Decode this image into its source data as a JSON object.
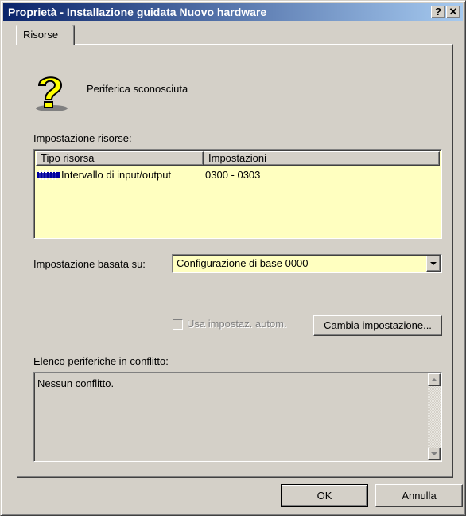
{
  "window": {
    "title": "Proprietà - Installazione guidata Nuovo hardware",
    "help_label": "?",
    "close_label": "✕"
  },
  "tabs": [
    {
      "label": "Risorse"
    }
  ],
  "device": {
    "name": "Periferica sconosciuta",
    "icon": "question-mark-icon"
  },
  "resources": {
    "label": "Impostazione risorse:",
    "columns": [
      "Tipo risorsa",
      "Impostazioni"
    ],
    "rows": [
      {
        "icon": "chip-icon",
        "type": "Intervallo di input/output",
        "value": "0300 - 0303"
      }
    ]
  },
  "setting_based": {
    "label": "Impostazione basata su:",
    "selected": "Configurazione di base 0000"
  },
  "auto_settings": {
    "label": "Usa impostaz. autom.",
    "checked": false,
    "enabled": false
  },
  "change_button": {
    "label": "Cambia impostazione..."
  },
  "conflicts": {
    "label": "Elenco periferiche in conflitto:",
    "text": "Nessun conflitto."
  },
  "buttons": {
    "ok": "OK",
    "cancel": "Annulla"
  },
  "colors": {
    "title_start": "#0a246a",
    "title_end": "#a6caf0",
    "face": "#d4d0c8",
    "list_background": "#ffffc0"
  }
}
